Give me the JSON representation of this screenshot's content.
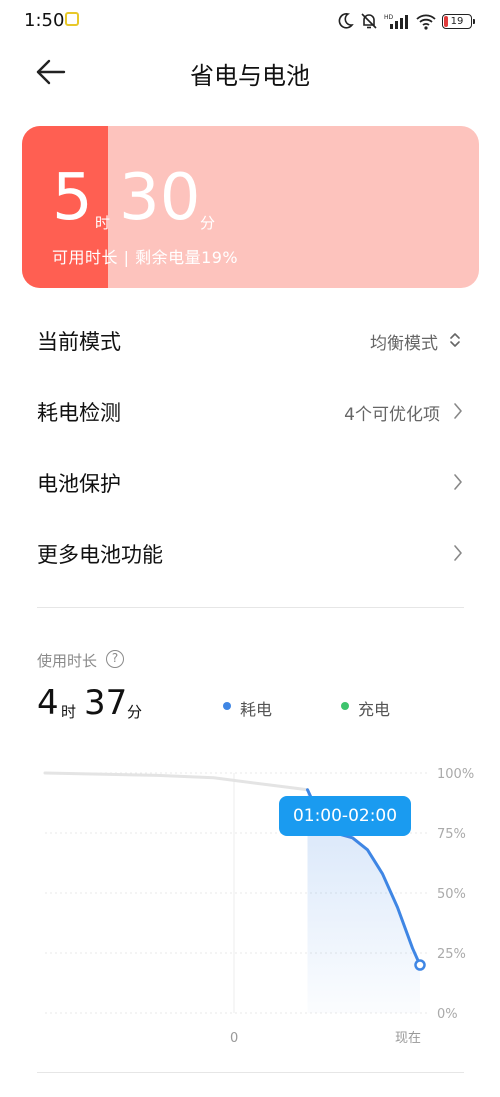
{
  "status_bar": {
    "time": "1:50",
    "battery_level": "19",
    "icons": [
      "moon-icon",
      "bell-muted-icon",
      "hd-signal-icon",
      "wifi-icon",
      "battery-icon"
    ]
  },
  "header": {
    "title": "省电与电池",
    "back_icon": "arrow-left-icon"
  },
  "battery_card": {
    "hours": "5",
    "hours_unit": "时",
    "minutes": "30",
    "minutes_unit": "分",
    "subtitle": "可用时长 | 剩余电量19%",
    "remaining_percent": 19,
    "colors": {
      "level": "#ff5f52",
      "background": "#fdc3bd"
    }
  },
  "settings": {
    "current_mode": {
      "label": "当前模式",
      "value": "均衡模式"
    },
    "power_check": {
      "label": "耗电检测",
      "value": "4个可优化项"
    },
    "battery_protection": {
      "label": "电池保护"
    },
    "more_functions": {
      "label": "更多电池功能"
    }
  },
  "usage": {
    "label": "使用时长",
    "hours": "4",
    "hours_unit": "时",
    "minutes": "37",
    "minutes_unit": "分",
    "legend": [
      {
        "label": "耗电",
        "color": "#3f86e4"
      },
      {
        "label": "充电",
        "color": "#3ec46d"
      }
    ]
  },
  "chart_data": {
    "type": "line",
    "y_ticks": [
      "100%",
      "75%",
      "50%",
      "25%",
      "0%"
    ],
    "ylim": [
      0,
      100
    ],
    "x_labels": [
      "0",
      "现在"
    ],
    "tooltip": "01:00-02:00",
    "series": [
      {
        "name": "耗电",
        "color": "#3f86e4",
        "highlighted_range": "01:00-02:00",
        "x": [
          0,
          0.3,
          0.45,
          0.6,
          0.7,
          0.75,
          0.82,
          0.86,
          0.9,
          0.94,
          0.98,
          1.0
        ],
        "values": [
          100,
          99,
          98,
          95,
          93,
          76,
          73,
          68,
          58,
          44,
          27,
          20
        ]
      }
    ]
  }
}
